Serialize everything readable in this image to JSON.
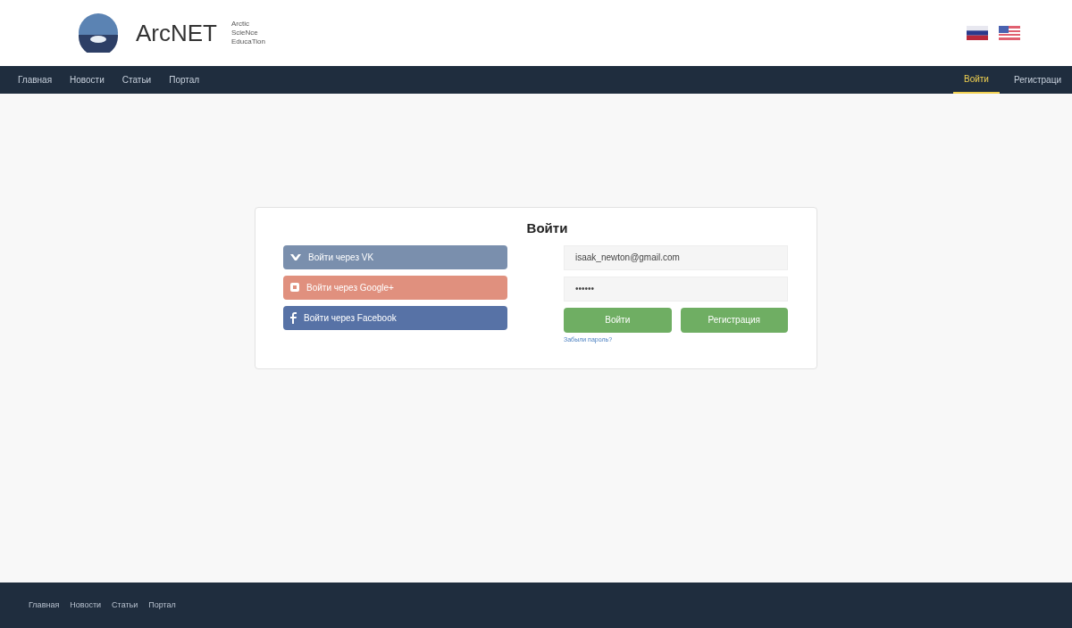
{
  "header": {
    "logo_text": "ArcNET",
    "tagline": [
      "Arctic",
      "ScieNce",
      "EducaTion"
    ]
  },
  "nav": {
    "left": [
      {
        "label": "Главная",
        "selected": false
      },
      {
        "label": "Новости",
        "selected": false
      },
      {
        "label": "Статьи",
        "selected": false
      },
      {
        "label": "Портал",
        "selected": false
      }
    ],
    "right": [
      {
        "label": "Войти",
        "selected": true
      },
      {
        "label": "Регистраци",
        "selected": false
      }
    ]
  },
  "login": {
    "title": "Войти",
    "social": [
      {
        "kind": "vk",
        "label": "Войти через VK"
      },
      {
        "kind": "google",
        "label": "Войти через Google+"
      },
      {
        "kind": "facebook",
        "label": "Войти через Facebook"
      }
    ],
    "email": {
      "value": "isaak_newton@gmail.com"
    },
    "password": {
      "value": "••••••"
    },
    "buttons": [
      "Войти",
      "Регистрация"
    ],
    "forgot": "Забыли пароль?"
  },
  "footer": {
    "links": [
      "Главная",
      "Новости",
      "Статьи",
      "Портал"
    ]
  }
}
